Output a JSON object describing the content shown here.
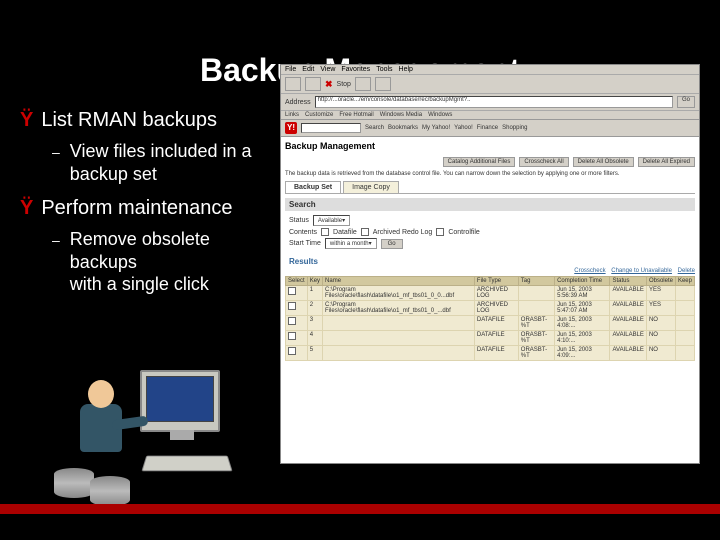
{
  "title": "Backup Management",
  "bullets": [
    {
      "text": "List RMAN backups",
      "sub": "View files included in a backup  set"
    },
    {
      "text": "Perform maintenance",
      "sub": "Remove obsolete backups\nwith a single click"
    }
  ],
  "screenshot": {
    "menu": [
      "File",
      "Edit",
      "View",
      "Favorites",
      "Tools",
      "Help"
    ],
    "stop_label": "Stop",
    "address_label": "Address",
    "address_value": "http://...oracle.../em/console/database/rec/backupMgmt?..",
    "go_label": "Go",
    "links_label": "Links",
    "links": [
      "Customize",
      "Free Hotmail",
      "Windows Media",
      "Windows"
    ],
    "yahoo_label": "Y!",
    "search_btn": "Search",
    "search_tabs": [
      "Bookmarks",
      "My Yahoo!",
      "Yahoo!",
      "Finance",
      "Shopping"
    ],
    "page_title": "Backup Management",
    "action_buttons": [
      "Catalog Additional Files",
      "Crosscheck All",
      "Delete All Obsolete",
      "Delete All Expired"
    ],
    "desc": "The backup data is retrieved from the database control file. You can narrow down the selection by applying one or more filters.",
    "tabs": [
      "Backup Set",
      "Image Copy"
    ],
    "search_header": "Search",
    "status_label": "Status",
    "status_value": "Available",
    "contents_label": "Contents",
    "contents_options": [
      "Datafile",
      "Archived Redo Log",
      "Controlfile"
    ],
    "start_label": "Start Time",
    "start_value": "within a month",
    "go": "Go",
    "results_label": "Results",
    "results_actions": [
      "Crosscheck",
      "Change to Unavailable",
      "Delete"
    ],
    "columns": [
      "Select",
      "Key",
      "Name",
      "File Type",
      "Tag",
      "Completion Time",
      "Status",
      "Obsolete",
      "Keep"
    ],
    "rows": [
      {
        "key": "1",
        "name": "C:\\Program Files\\oracle\\flash\\datafile\\o1_mf_tbs01_0_0...dbf",
        "file_type": "ARCHIVED LOG",
        "tag": "",
        "completion": "Jun 15, 2003 5:56:39 AM",
        "status": "AVAILABLE",
        "obsolete": "YES",
        "keep": ""
      },
      {
        "key": "2",
        "name": "C:\\Program Files\\oracle\\flash\\datafile\\o1_mf_tbs01_0_...dbf",
        "file_type": "ARCHIVED LOG",
        "tag": "",
        "completion": "Jun 15, 2003 5:47:07 AM",
        "status": "AVAILABLE",
        "obsolete": "YES",
        "keep": ""
      },
      {
        "key": "3",
        "name": "",
        "file_type": "DATAFILE",
        "tag": "ORASBT-%T",
        "completion": "Jun 15, 2003 4:08:... ",
        "status": "AVAILABLE",
        "obsolete": "NO",
        "keep": ""
      },
      {
        "key": "4",
        "name": "",
        "file_type": "DATAFILE",
        "tag": "ORASBT-%T",
        "completion": "Jun 15, 2003 4:10:...",
        "status": "AVAILABLE",
        "obsolete": "NO",
        "keep": ""
      },
      {
        "key": "5",
        "name": "",
        "file_type": "DATAFILE",
        "tag": "ORASBT-%T",
        "completion": "Jun 15, 2003 4:09:...",
        "status": "AVAILABLE",
        "obsolete": "NO",
        "keep": ""
      }
    ]
  }
}
